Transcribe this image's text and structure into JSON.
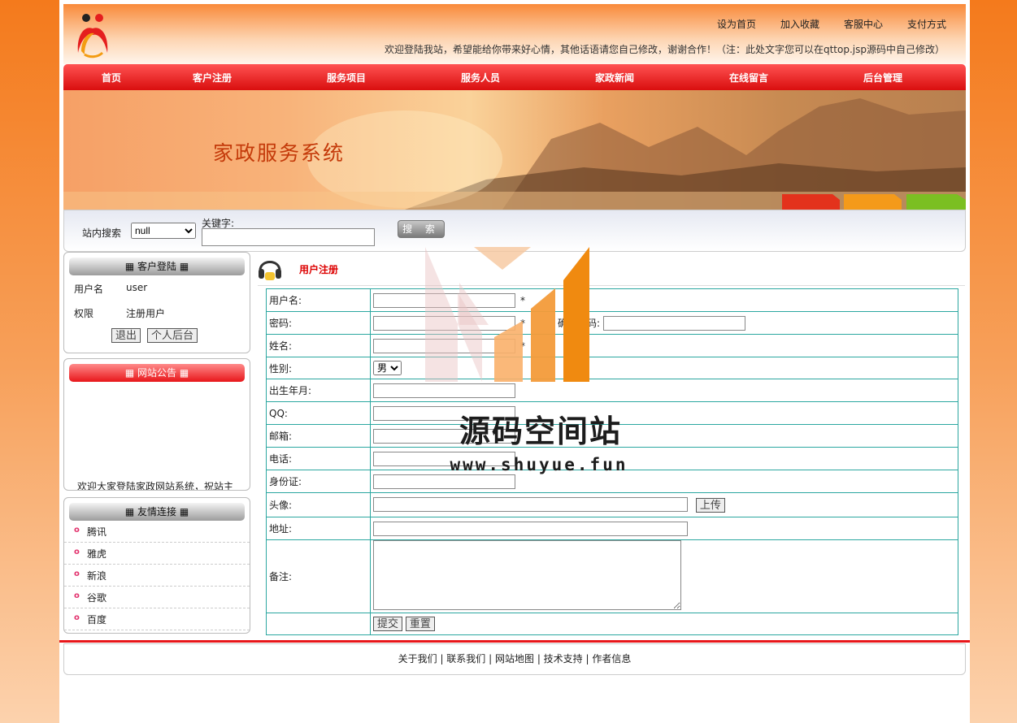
{
  "header": {
    "top_links": [
      "设为首页",
      "加入收藏",
      "客服中心",
      "支付方式"
    ],
    "welcome": "欢迎登陆我站，希望能给你带来好心情，其他话语请您自己修改，谢谢合作！（注：此处文字您可以在qttop.jsp源码中自己修改）"
  },
  "nav": [
    "首页",
    "客户注册",
    "服务项目",
    "服务人员",
    "家政新闻",
    "在线留言",
    "后台管理"
  ],
  "banner": {
    "title": "家政服务系统"
  },
  "search": {
    "label": "站内搜索",
    "select_value": "null",
    "keyword_label": "关键字:",
    "button": "搜 索"
  },
  "login_box": {
    "title": "客户登陆",
    "rows": [
      {
        "label": "用户名",
        "value": "user"
      },
      {
        "label": "权限",
        "value": "注册用户"
      }
    ],
    "logout_button": "退出",
    "backend_button": "个人后台"
  },
  "notice_box": {
    "title": "网站公告",
    "scroll_text": "欢迎大家登陆家政网站系统，祝站主"
  },
  "links_box": {
    "title": "友情连接",
    "items": [
      "腾讯",
      "雅虎",
      "新浪",
      "谷歌",
      "百度"
    ]
  },
  "content": {
    "title": "用户注册",
    "fields": {
      "username": "用户名:",
      "password": "密码:",
      "confirm_password": "确认密码:",
      "name": "姓名:",
      "gender": "性别:",
      "gender_value": "男",
      "birth": "出生年月:",
      "qq": "QQ:",
      "email": "邮箱:",
      "phone": "电话:",
      "idcard": "身份证:",
      "avatar": "头像:",
      "upload_button": "上传",
      "address": "地址:",
      "remark": "备注:",
      "required_mark": "*"
    },
    "submit_button": "提交",
    "reset_button": "重置"
  },
  "footer": {
    "links": [
      "关于我们",
      "联系我们",
      "网站地图",
      "技术支持",
      "作者信息"
    ],
    "separator": " | "
  },
  "watermark": {
    "text": "源码空间站",
    "url": "www.shuyue.fun"
  }
}
